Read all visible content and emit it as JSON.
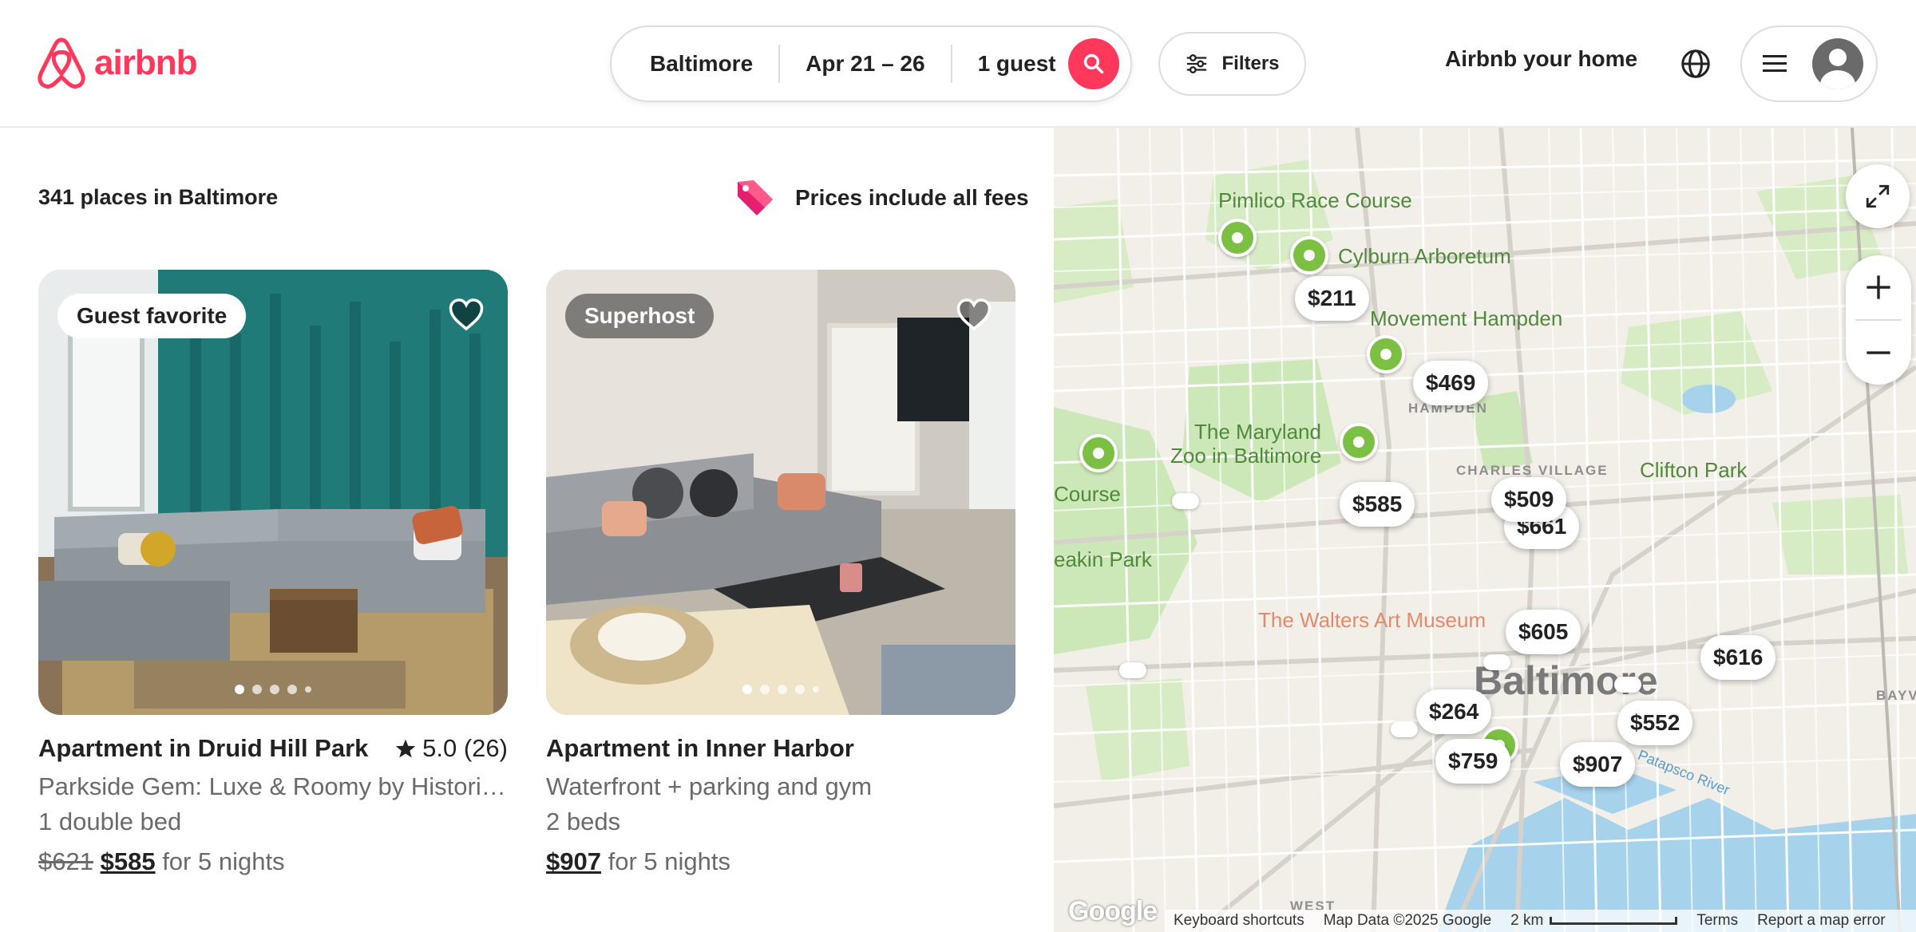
{
  "brand": {
    "name": "airbnb",
    "color": "#ff385c"
  },
  "search": {
    "location": "Baltimore",
    "dates": "Apr 21 – 26",
    "guests": "1 guest"
  },
  "header": {
    "filters_label": "Filters",
    "host_link": "Airbnb your home"
  },
  "results": {
    "count_text": "341 places in Baltimore",
    "fees_note": "Prices include all fees"
  },
  "listings": [
    {
      "badge": "Guest favorite",
      "title": "Apartment in Druid Hill Park",
      "rating": "5.0 (26)",
      "subtitle": "Parkside Gem: Luxe & Roomy by Historic...",
      "beds": "1 double bed",
      "original_price": "$621",
      "price": "$585",
      "price_suffix": "for 5 nights",
      "photo_index": 1,
      "photo_count": 5
    },
    {
      "badge": "Superhost",
      "title": "Apartment in Inner Harbor",
      "rating": "",
      "subtitle": "Waterfront + parking and gym",
      "beds": "2 beds",
      "original_price": "",
      "price": "$907",
      "price_suffix": "for 5 nights",
      "photo_index": 1,
      "photo_count": 5
    }
  ],
  "map": {
    "labels": {
      "pimlico": "Pimlico Race Course",
      "cylburn": "Cylburn Arboretum",
      "hampden_mv": "Movement Hampden",
      "hampden": "HAMPDEN",
      "zoo_1": "The Maryland",
      "zoo_2": "Zoo in Baltimore",
      "charles_village": "CHARLES VILLAGE",
      "clifton": "Clifton Park",
      "course": "Course",
      "leakin": "eakin Park",
      "walters": "The Walters Art Museum",
      "city": "Baltimore",
      "patapsco": "Patapsco River",
      "bayview": "BAYVIEW",
      "west": "WEST"
    },
    "prices": [
      "$211",
      "$469",
      "$585",
      "$509",
      "$661",
      "$605",
      "$616",
      "$264",
      "$552",
      "$759",
      "$907"
    ],
    "footer": {
      "shortcuts": "Keyboard shortcuts",
      "data": "Map Data ©2025 Google",
      "scale": "2 km",
      "terms": "Terms",
      "report": "Report a map error"
    },
    "logo": "Google"
  }
}
